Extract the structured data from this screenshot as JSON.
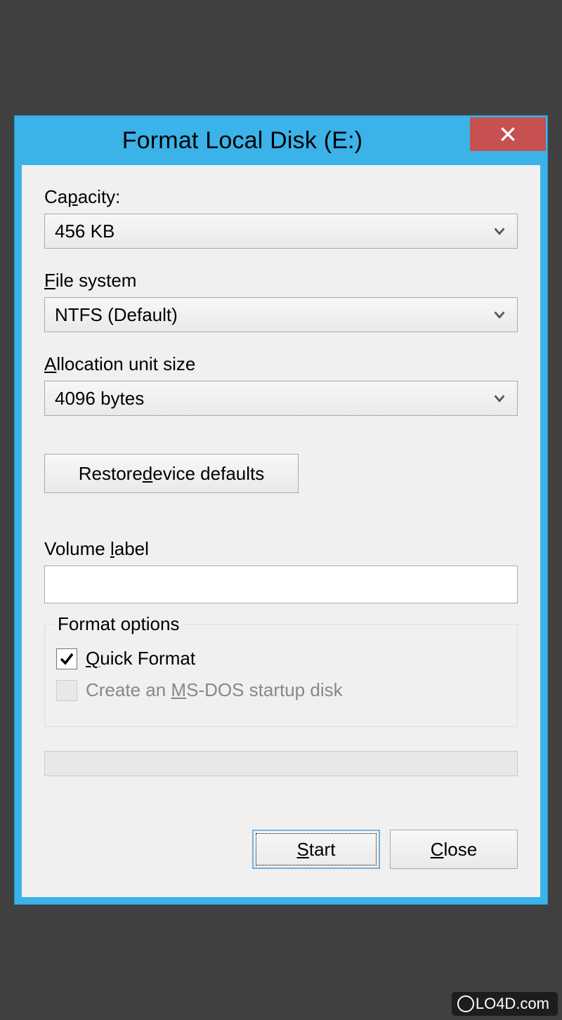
{
  "window": {
    "title": "Format Local Disk (E:)"
  },
  "capacity": {
    "label": "Capacity:",
    "value": "456 KB"
  },
  "filesystem": {
    "label_pre": "F",
    "label_post": "ile system",
    "value": "NTFS (Default)"
  },
  "allocation": {
    "label_pre": "A",
    "label_post": "llocation unit size",
    "value": "4096 bytes"
  },
  "restore": {
    "label_pre": "Restore ",
    "label_u": "d",
    "label_post": "evice defaults"
  },
  "volume": {
    "label_pre": "Volume ",
    "label_u": "l",
    "label_post": "abel",
    "value": ""
  },
  "options": {
    "legend": "Format options",
    "quick": {
      "checked": true,
      "label_pre": "Q",
      "label_post": "uick Format"
    },
    "msdos": {
      "checked": false,
      "disabled": true,
      "label_pre": "Create an ",
      "label_u": "M",
      "label_post": "S-DOS startup disk"
    }
  },
  "buttons": {
    "start_pre": "S",
    "start_post": "tart",
    "close_pre": "C",
    "close_post": "lose"
  },
  "watermark": "LO4D.com"
}
